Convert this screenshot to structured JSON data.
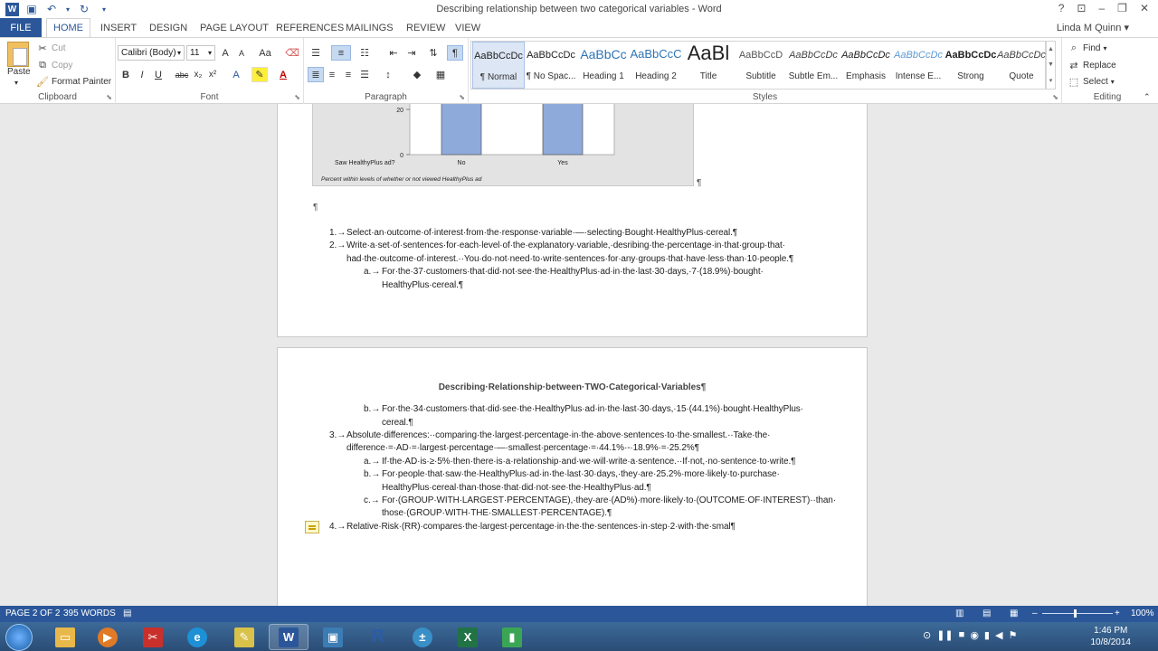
{
  "window": {
    "title": "Describing relationship between two categorical variables - Word",
    "user": "Linda M Quinn",
    "help": "?"
  },
  "tabs": [
    {
      "label": "FILE"
    },
    {
      "label": "HOME"
    },
    {
      "label": "INSERT"
    },
    {
      "label": "DESIGN"
    },
    {
      "label": "PAGE LAYOUT"
    },
    {
      "label": "REFERENCES"
    },
    {
      "label": "MAILINGS"
    },
    {
      "label": "REVIEW"
    },
    {
      "label": "VIEW"
    }
  ],
  "clipboard": {
    "paste": "Paste",
    "cut": "Cut",
    "copy": "Copy",
    "format_painter": "Format Painter",
    "label": "Clipboard"
  },
  "font": {
    "name": "Calibri (Body)",
    "size": "11",
    "label": "Font",
    "grow": "A",
    "shrink": "A",
    "change_case": "Aa",
    "bold": "B",
    "italic": "I",
    "underline": "U",
    "strike": "abc",
    "subscript": "x₂",
    "superscript": "x²"
  },
  "paragraph": {
    "label": "Paragraph"
  },
  "styles": {
    "label": "Styles",
    "items": [
      {
        "preview": "AaBbCcDc",
        "name": "¶ Normal"
      },
      {
        "preview": "AaBbCcDc",
        "name": "¶ No Spac..."
      },
      {
        "preview": "AaBbCc",
        "name": "Heading 1"
      },
      {
        "preview": "AaBbCcC",
        "name": "Heading 2"
      },
      {
        "preview": "AaBl",
        "name": "Title"
      },
      {
        "preview": "AaBbCcD",
        "name": "Subtitle"
      },
      {
        "preview": "AaBbCcDc",
        "name": "Subtle Em..."
      },
      {
        "preview": "AaBbCcDc",
        "name": "Emphasis"
      },
      {
        "preview": "AaBbCcDc",
        "name": "Intense E..."
      },
      {
        "preview": "AaBbCcDc",
        "name": "Strong"
      },
      {
        "preview": "AaBbCcDc",
        "name": "Quote"
      }
    ]
  },
  "editing": {
    "label": "Editing",
    "find": "Find",
    "replace": "Replace",
    "select": "Select"
  },
  "chart": {
    "row_label": "Saw HealthyPlus ad?",
    "categories": [
      "No",
      "Yes"
    ],
    "ticks": [
      "20",
      "0"
    ],
    "footnote": "Percent within levels of whether or not viewed HealthyPlus ad"
  },
  "page1": {
    "pilcrow": "¶",
    "item1": "Select·an·outcome·of·interest·from·the·response·variable·—·selecting·Bought·HealthyPlus·cereal.¶",
    "item2a": "Write·a·set·of·sentences·for·each·level·of·the·explanatory·variable,·desribing·the·percentage·in·that·group·that·",
    "item2b": "had·the·outcome·of·interest.··You·do·not·need·to·write·sentences·for·any·groups·that·have·less·than·10·people.¶",
    "item2_a1": "For·the·37·customers·that·did·not·see·the·HealthyPlus·ad·in·the·last·30·days,·7·(18.9%)·bought·",
    "item2_a2": "HealthyPlus·cereal.¶",
    "n1": "1.→",
    "n2": "2.→",
    "na": "a.→"
  },
  "page2": {
    "heading": "Describing·Relationship·between·TWO·Categorical·Variables¶",
    "b1": "For·the·34·customers·that·did·see·the·HealthyPlus·ad·in·the·last·30·days,·15·(44.1%)·bought·HealthyPlus·",
    "b2": "cereal.¶",
    "i3a": "Absolute·differences:··comparing·the·largest·percentage·in·the·above·sentences·to·the·smallest.··Take·the·",
    "i3b": "difference·=·AD·=·largest·percentage·—·smallest·percentage·=·44.1%·-·18.9%·=·25.2%¶",
    "a1": "If·the·AD·is·≥·5%·then·there·is·a·relationship·and·we·will·write·a·sentence.··If·not,·no·sentence·to·write.¶",
    "b3a": "For·people·that·saw·the·HealthyPlus·ad·in·the·last·30·days,·they·are·25.2%·more·likely·to·purchase·",
    "b3b": "HealthyPlus·cereal·than·those·that·did·not·see·the·HealthyPlus·ad.¶",
    "c1": "For·(GROUP·WITH·LARGEST·PERCENTAGE),·they·are·(AD%)·more·likely·to·(OUTCOME·OF·INTEREST)··than·",
    "c2": "those·(GROUP·WITH·THE·SMALLEST·PERCENTAGE).¶",
    "i4": "Relative·Risk·(RR)·compares·the·largest·percentage·in·the·the·sentences·in·step·2·with·the·smal¶",
    "nb": "b.→",
    "n3": "3.→",
    "na": "a.→",
    "nb2": "b.→",
    "nc": "c.→",
    "n4": "4.→"
  },
  "status": {
    "page": "PAGE 2 OF 2",
    "words": "395 WORDS",
    "zoom": "100%",
    "zoom_level": 100
  },
  "clock": {
    "time": "1:46 PM",
    "date": "10/8/2014"
  },
  "colors": {
    "accent": "#2b579a",
    "bar": "#8eaadb"
  }
}
